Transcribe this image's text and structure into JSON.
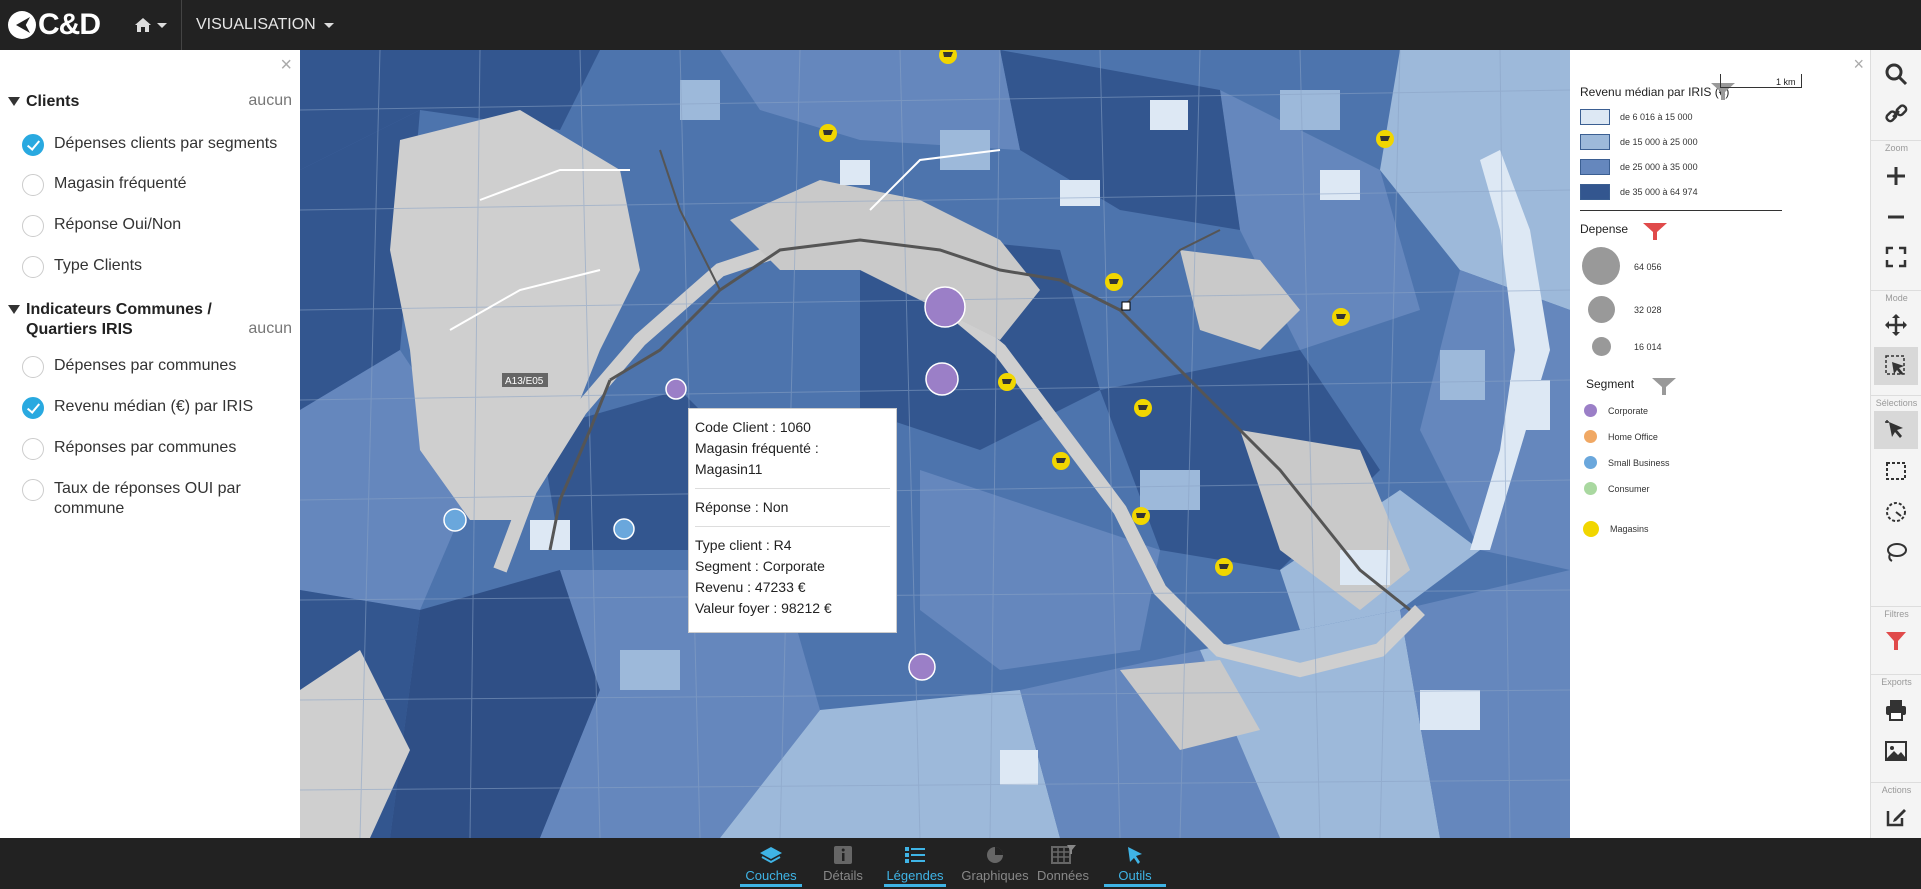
{
  "app": {
    "logo_text": "C&D",
    "menu_label": "VISUALISATION"
  },
  "left_panel": {
    "groups": [
      {
        "title": "Clients",
        "none_label": "aucun",
        "layers": [
          {
            "label": "Dépenses clients par segments",
            "checked": true
          },
          {
            "label": "Magasin fréquenté",
            "checked": false
          },
          {
            "label": "Réponse Oui/Non",
            "checked": false
          },
          {
            "label": "Type Clients",
            "checked": false
          }
        ]
      },
      {
        "title": "Indicateurs Communes / Quartiers IRIS",
        "none_label": "aucun",
        "layers": [
          {
            "label": "Dépenses par communes",
            "checked": false
          },
          {
            "label": "Revenu médian (€) par IRIS",
            "checked": true
          },
          {
            "label": "Réponses par communes",
            "checked": false
          },
          {
            "label": "Taux de réponses OUI par commune",
            "checked": false
          }
        ]
      }
    ]
  },
  "popup": {
    "code": "Code Client : 1060",
    "store": "Magasin fréquenté : Magasin11",
    "response": "Réponse : Non",
    "type": "Type client : R4",
    "segment": "Segment : Corporate",
    "revenue": "Revenu : 47233 €",
    "home_value": "Valeur foyer : 98212 €"
  },
  "map_labels": {
    "road_a13": "A13/E05",
    "scale": "1 km"
  },
  "legend": {
    "income_title": "Revenu médian par IRIS (€)",
    "income_classes": [
      {
        "label": "de 6 016 à 15 000",
        "color": "#dde8f4"
      },
      {
        "label": "de 15 000 à 25 000",
        "color": "#9db9da"
      },
      {
        "label": "de 25 000 à 35 000",
        "color": "#6587bd"
      },
      {
        "label": "de 35 000 à 64 974",
        "color": "#33568f"
      }
    ],
    "spend_title": "Depense",
    "spend_values": [
      "64 056",
      "32 028",
      "16 014"
    ],
    "segment_title": "Segment",
    "segments": [
      {
        "label": "Corporate",
        "color": "#9b7fc7"
      },
      {
        "label": "Home Office",
        "color": "#f0a864"
      },
      {
        "label": "Small Business",
        "color": "#6aa7dc"
      },
      {
        "label": "Consumer",
        "color": "#a9d8a0"
      }
    ],
    "stores_label": "Magasins"
  },
  "toolbar": {
    "sections": {
      "zoom": "Zoom",
      "mode": "Mode",
      "selections": "Sélections",
      "filters": "Filtres",
      "exports": "Exports",
      "actions": "Actions"
    }
  },
  "bottom_tabs": [
    {
      "label": "Couches",
      "active": true
    },
    {
      "label": "Détails",
      "active": false
    },
    {
      "label": "Légendes",
      "active": true
    },
    {
      "label": "Graphiques",
      "active": false
    },
    {
      "label": "Données",
      "active": false
    },
    {
      "label": "Outils",
      "active": true
    }
  ]
}
